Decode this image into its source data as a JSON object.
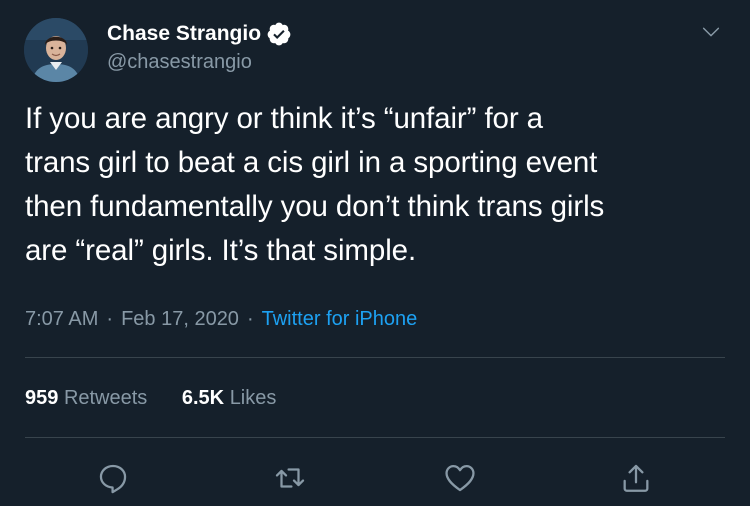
{
  "colors": {
    "background": "#15202b",
    "primary_text": "#ffffff",
    "secondary_text": "#8899a6",
    "link": "#1da1f2",
    "divider": "#38444d"
  },
  "author": {
    "display_name": "Chase Strangio",
    "handle": "@chasestrangio",
    "verified": true,
    "avatar_icon": "avatar-photo",
    "verified_icon": "verified-badge-icon",
    "menu_icon": "chevron-down-icon"
  },
  "tweet": {
    "lines": [
      "If you are angry or think it’s “unfair” for a",
      "trans girl to beat a cis girl in a sporting event",
      "then fundamentally you don’t think trans girls",
      "are “real” girls. It’s that simple."
    ]
  },
  "meta": {
    "time": "7:07 AM",
    "separator": "·",
    "date": "Feb 17, 2020",
    "source": "Twitter for iPhone"
  },
  "stats": {
    "retweets_count": "959",
    "retweets_label": "Retweets",
    "likes_count": "6.5K",
    "likes_label": "Likes"
  },
  "actions": {
    "reply_icon": "reply-icon",
    "retweet_icon": "retweet-icon",
    "like_icon": "heart-icon",
    "share_icon": "share-icon"
  }
}
